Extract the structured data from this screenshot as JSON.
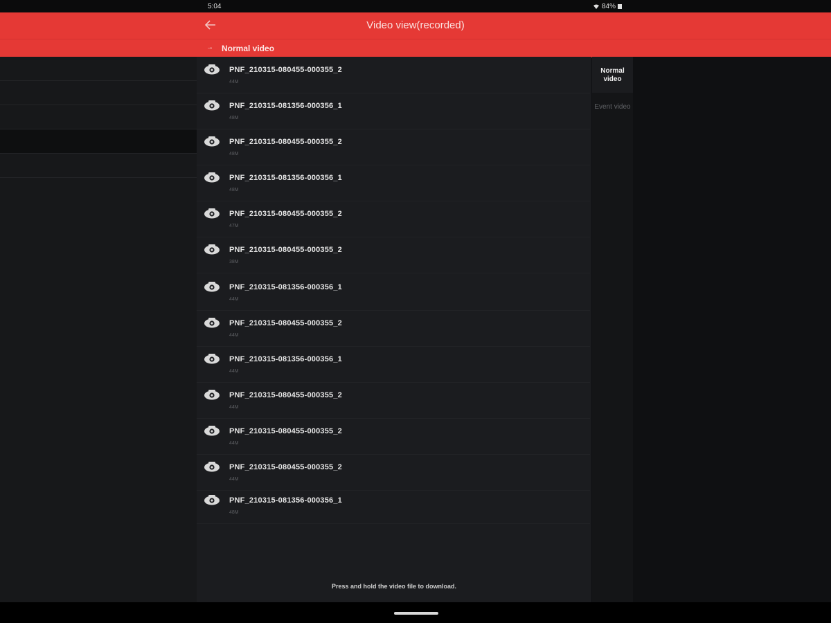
{
  "status": {
    "time": "5:04",
    "battery": "84%"
  },
  "appbar": {
    "back_icon": "arrow-left-icon",
    "title": "Video view(recorded)"
  },
  "subbar": {
    "arrow": "→",
    "label": "Normal video"
  },
  "files": [
    {
      "name": "PNF_210315-080455-000355_2",
      "size": "44M"
    },
    {
      "name": "PNF_210315-081356-000356_1",
      "size": "48M"
    },
    {
      "name": "PNF_210315-080455-000355_2",
      "size": "48M"
    },
    {
      "name": "PNF_210315-081356-000356_1",
      "size": "48M"
    },
    {
      "name": "PNF_210315-080455-000355_2",
      "size": "47M"
    },
    {
      "name": "PNF_210315-080455-000355_2",
      "size": "38M"
    },
    {
      "name": "PNF_210315-081356-000356_1",
      "size": "44M"
    },
    {
      "name": "PNF_210315-080455-000355_2",
      "size": "44M"
    },
    {
      "name": "PNF_210315-081356-000356_1",
      "size": "44M"
    },
    {
      "name": "PNF_210315-080455-000355_2",
      "size": "44M"
    },
    {
      "name": "PNF_210315-080455-000355_2",
      "size": "44M"
    },
    {
      "name": "PNF_210315-080455-000355_2",
      "size": "44M"
    },
    {
      "name": "PNF_210315-081356-000356_1",
      "size": "48M"
    }
  ],
  "download_hint": "Press and hold the video file to download.",
  "tabs": [
    {
      "label": "Normal video",
      "active": true
    },
    {
      "label": "Event video",
      "active": false
    }
  ],
  "colors": {
    "accent": "#e53935",
    "background": "#1b1c1f"
  }
}
